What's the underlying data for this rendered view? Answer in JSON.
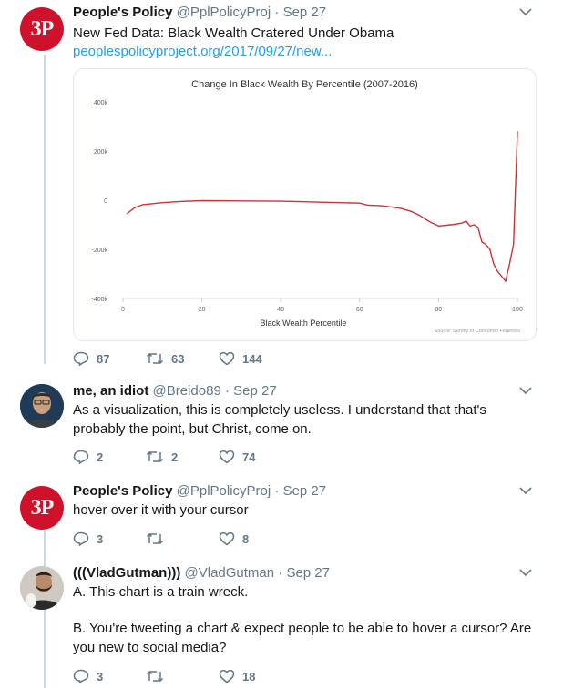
{
  "tweets": [
    {
      "name": "People's Policy",
      "handle": "@PplPolicyProj",
      "sep": "·",
      "date": "Sep 27",
      "avatar_text": "3P",
      "text": "New Fed Data: Black Wealth Cratered Under Obama",
      "link": "peoplespolicyproject.org/2017/09/27/new...",
      "replies": "87",
      "retweets": "63",
      "likes": "144"
    },
    {
      "name": "me, an idiot",
      "handle": "@Breido89",
      "sep": "·",
      "date": "Sep 27",
      "text": "As a visualization, this is completely useless. I understand that that's probably the point, but Christ, come on.",
      "replies": "2",
      "retweets": "2",
      "likes": "74"
    },
    {
      "name": "People's Policy",
      "handle": "@PplPolicyProj",
      "sep": "·",
      "date": "Sep 27",
      "avatar_text": "3P",
      "text": "hover over it with your cursor",
      "replies": "3",
      "retweets": "",
      "likes": "8"
    },
    {
      "name": "(((VladGutman)))",
      "handle": "@VladGutman",
      "sep": "·",
      "date": "Sep 27",
      "text_a": "A. This chart is a train wreck.",
      "text_b": "B. You're tweeting a chart & expect people to be able to hover a cursor? Are you new to social media?",
      "replies": "3",
      "retweets": "",
      "likes": "18"
    }
  ],
  "colors": {
    "brand_red": "#d0112b",
    "link_blue": "#1da1f2",
    "line": "#c9343a",
    "muted": "#657786"
  },
  "icons": [
    "reply-icon",
    "retweet-icon",
    "like-icon",
    "chevron-down-icon"
  ],
  "chart_data": {
    "type": "line",
    "title": "Change In Black Wealth By Percentile (2007-2016)",
    "xlabel": "Black Wealth Percentile",
    "ylabel": "",
    "source": "Source: Survey of Consumer Finances",
    "xlim": [
      0,
      100
    ],
    "ylim": [
      -400000,
      400000
    ],
    "x_ticks": [
      "0",
      "20",
      "40",
      "60",
      "80",
      "100"
    ],
    "y_ticks": [
      "400k",
      "200k",
      "0",
      "-200k",
      "-400k"
    ],
    "series": [
      {
        "x": [
          1,
          3,
          5,
          10,
          15,
          20,
          30,
          40,
          45,
          50,
          55,
          60,
          62,
          65,
          67,
          70,
          73,
          75,
          77,
          78,
          80,
          82,
          84,
          86,
          87,
          88,
          89,
          90,
          91,
          92,
          93,
          94,
          95,
          96,
          97,
          98,
          99,
          100
        ],
        "y": [
          -55000,
          -30000,
          -18000,
          -10000,
          -5000,
          -2000,
          -3000,
          -4000,
          -6000,
          -8000,
          -10000,
          -12000,
          -20000,
          -22000,
          -25000,
          -32000,
          -45000,
          -60000,
          -80000,
          -90000,
          -105000,
          -102000,
          -98000,
          -93000,
          -85000,
          -105000,
          -100000,
          -110000,
          -170000,
          -180000,
          -200000,
          -260000,
          -290000,
          -310000,
          -330000,
          -260000,
          -180000,
          280000
        ]
      }
    ]
  }
}
